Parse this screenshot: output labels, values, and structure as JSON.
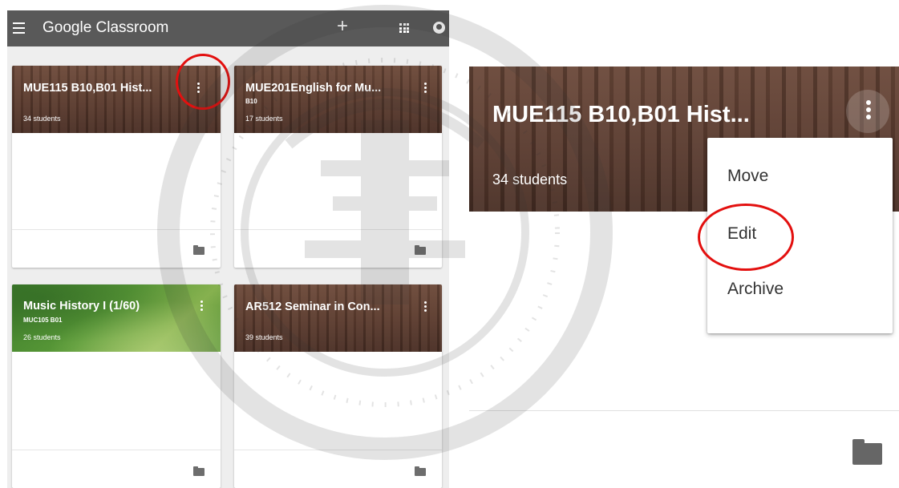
{
  "topbar": {
    "title": "Google Classroom",
    "menu_icon": "hamburger-menu-icon",
    "add_icon": "plus-icon",
    "apps_icon": "apps-grid-icon",
    "account_icon": "account-icon",
    "bar_color": "#595959"
  },
  "cards": [
    {
      "title": "MUE115 B10,B01 Hist...",
      "section": "",
      "students": "34 students",
      "theme": "brown"
    },
    {
      "title": "MUE201English for Mu...",
      "section": "B10",
      "students": "17 students",
      "theme": "brown"
    },
    {
      "title": "Music History I (1/60)",
      "section": "MUC105 B01",
      "students": "26 students",
      "theme": "green"
    },
    {
      "title": "AR512 Seminar in Con...",
      "section": "",
      "students": "39 students",
      "theme": "brown"
    }
  ],
  "detail": {
    "title": "MUE115 B10,B01 Hist...",
    "students": "34 students",
    "menu": {
      "items": [
        "Move",
        "Edit",
        "Archive"
      ]
    }
  },
  "highlight_color": "#e3100f"
}
